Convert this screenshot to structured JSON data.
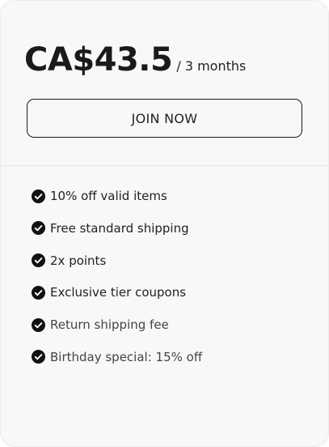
{
  "plan": {
    "price": "CA$43.5",
    "period": "/ 3 months"
  },
  "cta": {
    "label": "JOIN NOW"
  },
  "benefits": [
    {
      "label": "10% off valid items",
      "icon": "check-circle-icon"
    },
    {
      "label": "Free standard shipping",
      "icon": "check-circle-icon"
    },
    {
      "label": "2x points",
      "icon": "check-circle-icon"
    },
    {
      "label": "Exclusive tier coupons",
      "icon": "check-circle-icon"
    },
    {
      "label": "Return shipping fee",
      "icon": "check-circle-icon"
    },
    {
      "label": "Birthday special: 15% off",
      "icon": "check-circle-icon"
    }
  ],
  "colors": {
    "card_background": "#f8f8f8",
    "text": "#1a1a1a",
    "divider": "#e4e4e4"
  }
}
